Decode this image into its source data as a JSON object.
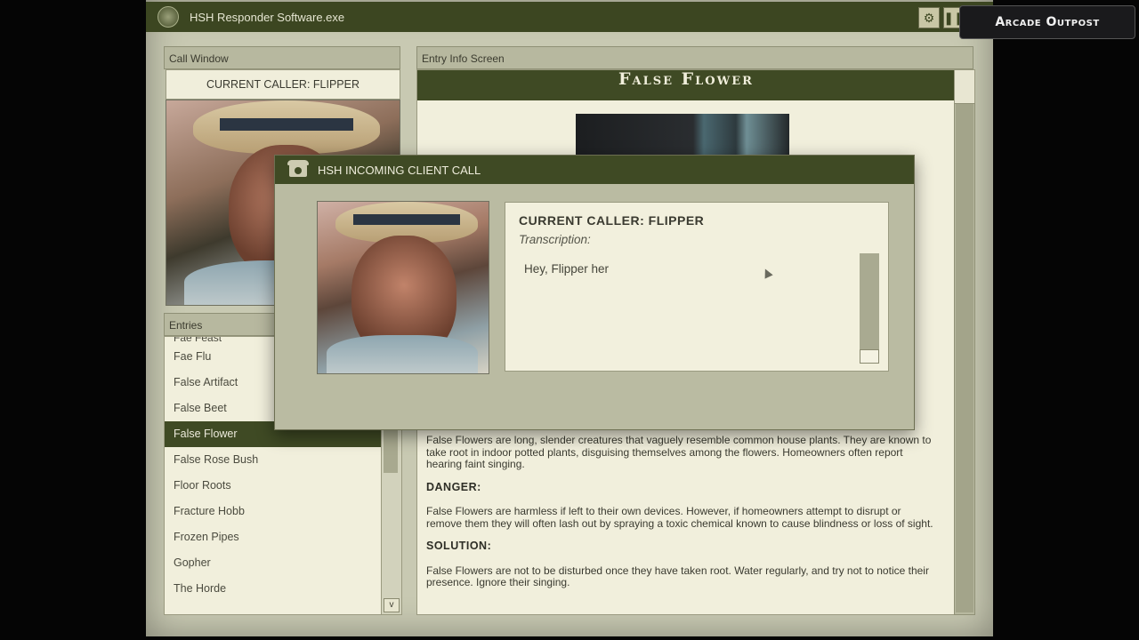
{
  "app": {
    "title": "HSH Responder Software.exe",
    "settings_icon": "gear-icon",
    "pause_icon": "pause-icon"
  },
  "call_window": {
    "header": "Call Window",
    "current_caller": "CURRENT CALLER: FLIPPER"
  },
  "entries": {
    "header": "Entries",
    "clipped_item": "Fae Feast",
    "items": [
      {
        "label": "Fae Flu",
        "selected": false
      },
      {
        "label": "False Artifact",
        "selected": false
      },
      {
        "label": "False Beet",
        "selected": false
      },
      {
        "label": "False Flower",
        "selected": true
      },
      {
        "label": "False Rose Bush",
        "selected": false
      },
      {
        "label": "Floor Roots",
        "selected": false
      },
      {
        "label": "Fracture Hobb",
        "selected": false
      },
      {
        "label": "Frozen Pipes",
        "selected": false
      },
      {
        "label": "Gopher",
        "selected": false
      },
      {
        "label": "The Horde",
        "selected": false
      }
    ],
    "scroll_down": "v"
  },
  "entry_info": {
    "header": "Entry Info Screen",
    "title": "False Flower",
    "description": "False Flowers are long, slender creatures that vaguely resemble common house plants. They are known to take root in indoor potted plants, disguising themselves among the flowers. Homeowners often report hearing faint singing.",
    "danger_heading": "DANGER:",
    "danger_text": "False Flowers are harmless if left to their own devices. However, if homeowners attempt to disrupt or remove them they will often lash out by spraying a toxic chemical known to cause blindness or loss of sight.",
    "solution_heading": "SOLUTION:",
    "solution_text": "False Flowers are not to be disturbed once they have taken root. Water regularly, and try not to notice their presence. Ignore their singing."
  },
  "incoming_call": {
    "title": "HSH INCOMING CLIENT CALL",
    "icon": "phone-icon",
    "caller": "CURRENT CALLER: FLIPPER",
    "transcription_label": "Transcription:",
    "transcription_text": "Hey, Flipper her"
  },
  "watermark": "Arcade Outpost"
}
